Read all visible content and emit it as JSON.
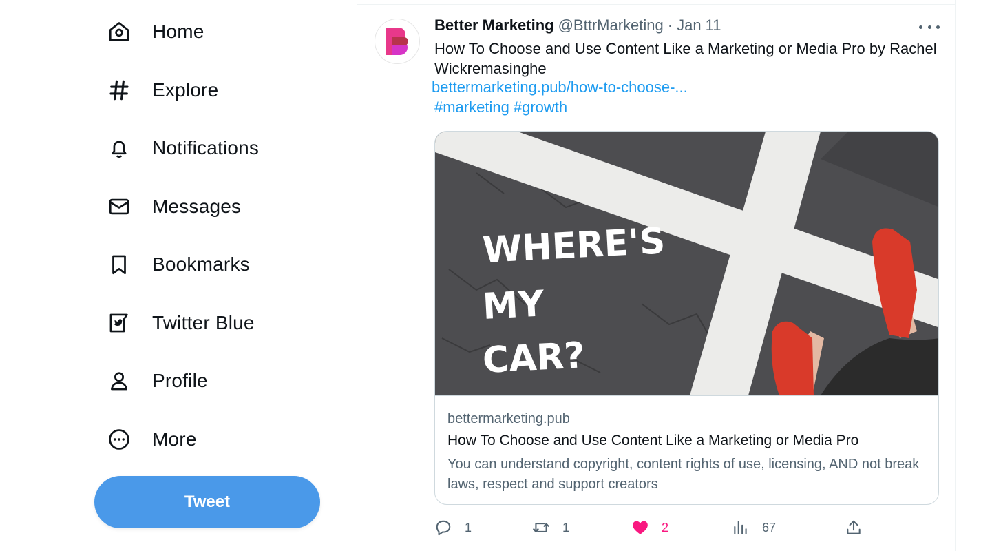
{
  "sidebar": {
    "items": [
      {
        "label": "Home",
        "icon": "home-icon"
      },
      {
        "label": "Explore",
        "icon": "hashtag-icon"
      },
      {
        "label": "Notifications",
        "icon": "bell-icon"
      },
      {
        "label": "Messages",
        "icon": "envelope-icon"
      },
      {
        "label": "Bookmarks",
        "icon": "bookmark-icon"
      },
      {
        "label": "Twitter Blue",
        "icon": "twitter-blue-icon"
      },
      {
        "label": "Profile",
        "icon": "person-icon"
      },
      {
        "label": "More",
        "icon": "more-circle-icon"
      }
    ],
    "tweet_button": "Tweet"
  },
  "tweet": {
    "author_name": "Better Marketing",
    "author_handle": "@BttrMarketing",
    "separator": "·",
    "date": "Jan 11",
    "text": "How To Choose and Use Content Like a Marketing or Media Pro by Rachel Wickremasinghe",
    "link": "bettermarketing.pub/how-to-choose-...",
    "hashtags": [
      "#marketing",
      "#growth"
    ],
    "card": {
      "image_text": [
        "WHERE'S",
        "MY",
        "CAR?"
      ],
      "domain": "bettermarketing.pub",
      "title": "How To Choose and Use Content Like a Marketing or Media Pro",
      "description": "You can understand copyright, content rights of use, licensing, AND not break laws, respect and support creators"
    },
    "actions": {
      "replies": "1",
      "retweets": "1",
      "likes": "2",
      "views": "67"
    }
  },
  "colors": {
    "accent": "#1d9bf0",
    "tweet_button": "#4a99e9",
    "like": "#f91880",
    "brand_avatar": "#e8388a"
  }
}
